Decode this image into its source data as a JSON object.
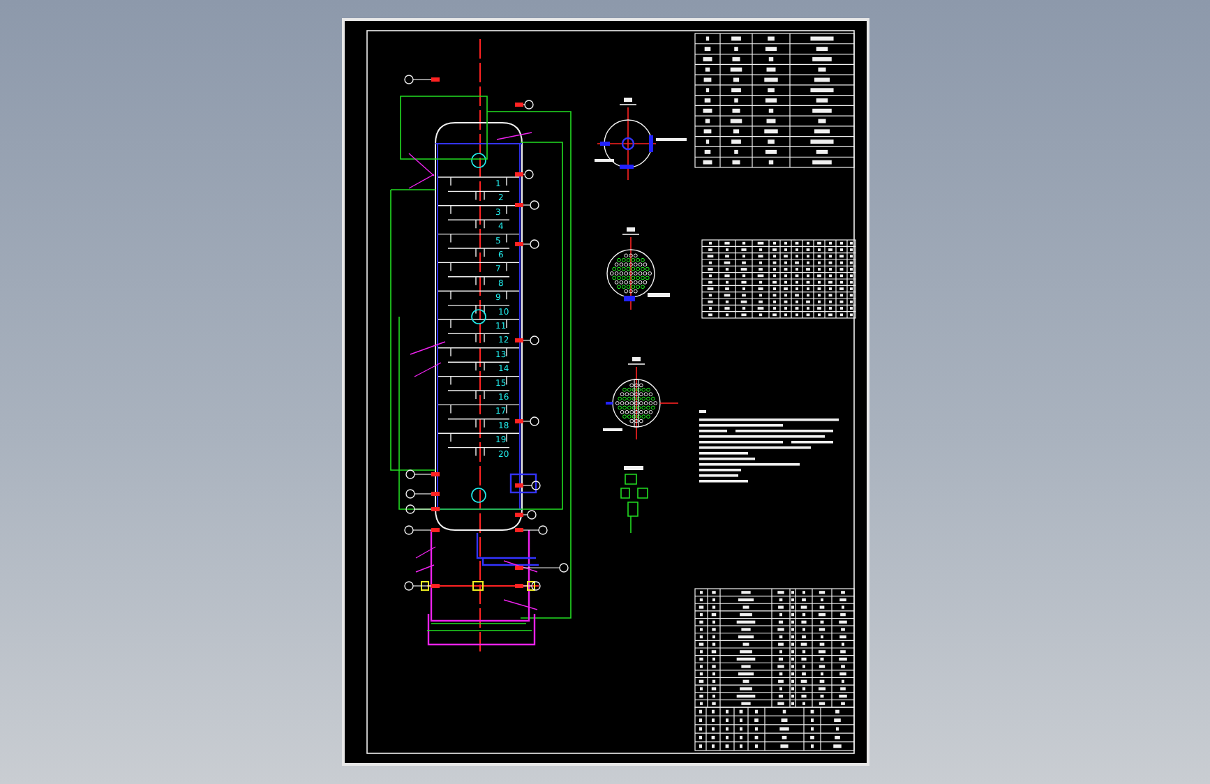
{
  "column": {
    "tray_numbers": [
      "1",
      "2",
      "3",
      "4",
      "5",
      "6",
      "7",
      "8",
      "9",
      "10",
      "11",
      "12",
      "13",
      "14",
      "15",
      "16",
      "17",
      "18",
      "19",
      "20"
    ]
  }
}
